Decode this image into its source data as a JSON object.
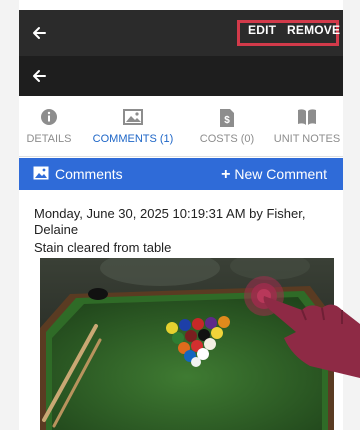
{
  "header": {
    "edit_label": "EDIT",
    "remove_label": "REMOVE",
    "highlight_color": "#d23a4a"
  },
  "tabs": [
    {
      "label": "DETAILS",
      "icon": "info-icon",
      "active": false
    },
    {
      "label": "COMMENTS (1)",
      "icon": "image-icon",
      "active": true
    },
    {
      "label": "COSTS (0)",
      "icon": "receipt-dollar-icon",
      "active": false
    },
    {
      "label": "UNIT NOTES",
      "icon": "book-icon",
      "active": false
    }
  ],
  "section": {
    "title": "Comments",
    "new_comment_label": "New Comment",
    "accent": "#2f6bd8"
  },
  "comment": {
    "meta": "Monday, June 30, 2025 10:19:31 AM by Fisher, Delaine",
    "text": "Stain cleared from table",
    "photo_icon": "pool-table-photo"
  },
  "overlay": {
    "icon": "tap-hand-icon"
  }
}
